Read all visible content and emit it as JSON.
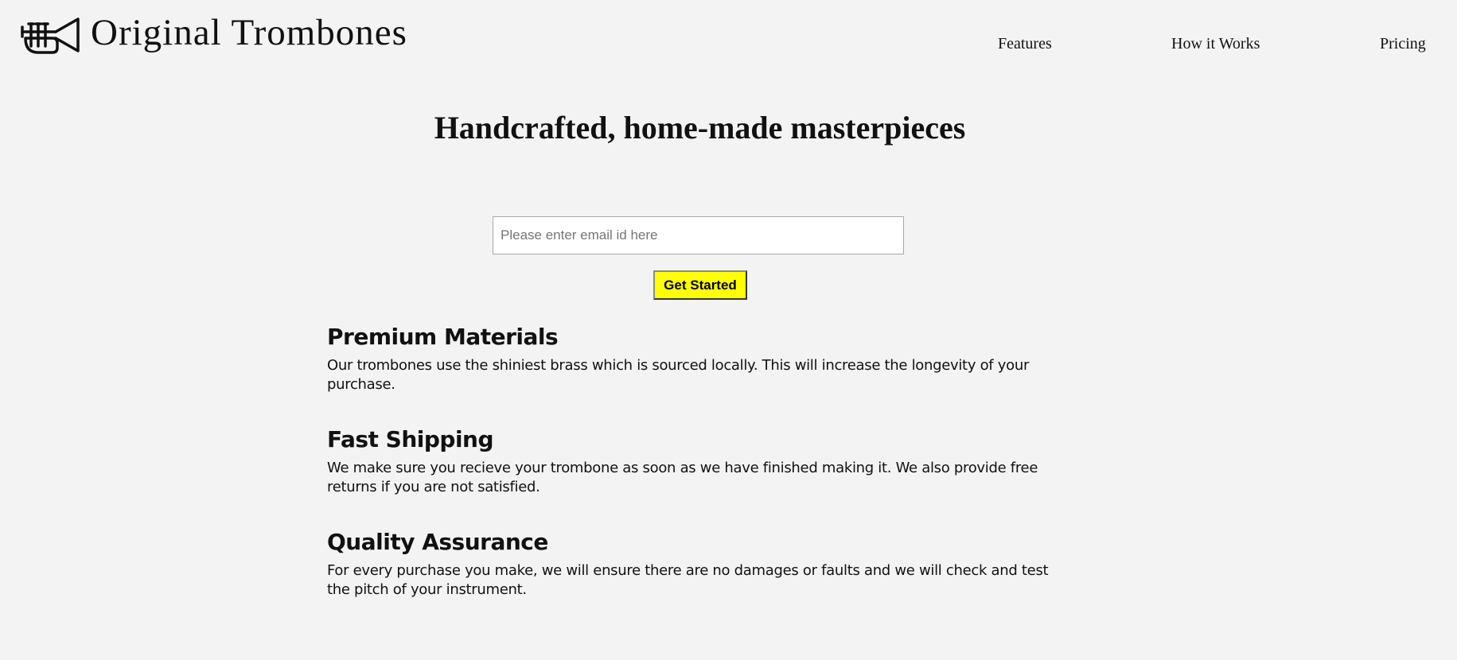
{
  "header": {
    "brand": "Original Trombones",
    "logo_icon": "trumpet-icon",
    "nav": [
      {
        "label": "Features"
      },
      {
        "label": "How it Works"
      },
      {
        "label": "Pricing"
      }
    ]
  },
  "hero": {
    "title": "Handcrafted, home-made masterpieces",
    "email_placeholder": "Please enter email id here",
    "email_value": "",
    "cta_label": "Get Started",
    "cta_color": "#ffff00"
  },
  "features": [
    {
      "title": "Premium Materials",
      "text": "Our trombones use the shiniest brass which is sourced locally. This will increase the longevity of your purchase."
    },
    {
      "title": "Fast Shipping",
      "text": "We make sure you recieve your trombone as soon as we have finished making it. We also provide free returns if you are not satisfied."
    },
    {
      "title": "Quality Assurance",
      "text": "For every purchase you make, we will ensure there are no damages or faults and we will check and test the pitch of your instrument."
    }
  ],
  "colors": {
    "background": "#f3f3f3",
    "text": "#111111",
    "cta": "#ffff00"
  }
}
